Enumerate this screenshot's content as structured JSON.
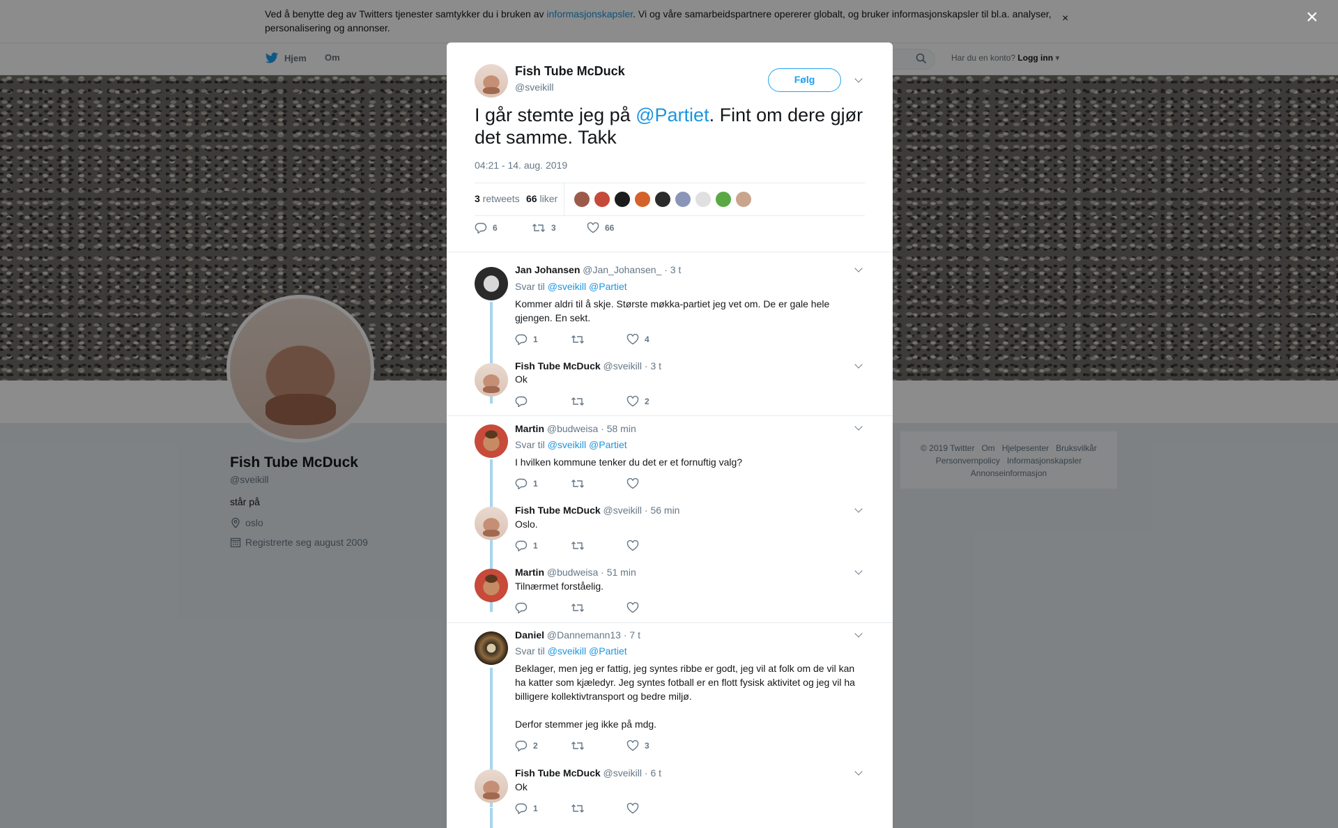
{
  "cookie": {
    "text_before": "Ved å benytte deg av Twitters tjenester samtykker du i bruken av ",
    "link": "informasjonskapsler",
    "text_after": ". Vi og våre samarbeidspartnere opererer globalt, og bruker informasjonskapsler til bl.a. analyser, personalisering og annonser.",
    "close": "×"
  },
  "nav": {
    "home": "Hjem",
    "about": "Om",
    "login_prompt": "Har du en konto?",
    "login": "Logg inn"
  },
  "profile": {
    "name": "Fish Tube McDuck",
    "handle": "@sveikill",
    "bio": "står på",
    "location": "oslo",
    "joined": "Registrerte seg august 2009"
  },
  "footer": {
    "links": [
      "© 2019 Twitter",
      "Om",
      "Hjelpesenter",
      "Bruksvilkår",
      "Personvernpolicy",
      "Informasjonskapsler",
      "Annonseinformasjon"
    ]
  },
  "overlay_close": "×",
  "tweet": {
    "name": "Fish Tube McDuck",
    "handle": "@sveikill",
    "follow": "Følg",
    "text_before": "I går stemte jeg på ",
    "mention": "@Partiet",
    "text_after": ". Fint om dere gjør det samme. Takk",
    "time": "04:21 - 14. aug. 2019",
    "retweets_count": "3",
    "retweets_label": " retweets",
    "likes_count": "66",
    "likes_label": " liker",
    "liker_colors": [
      "#9c5b4a",
      "#c44a3a",
      "#1c1c1c",
      "#d4622a",
      "#2b2b2b",
      "#8a96b8",
      "#e0e0e0",
      "#5aa843",
      "#c9a58d"
    ],
    "actions": {
      "replies": "6",
      "retweets": "3",
      "likes": "66"
    }
  },
  "replies": [
    {
      "name": "Jan Johansen",
      "handle": "@Jan_Johansen_",
      "time": "· 3 t",
      "reply_prefix": "Svar til ",
      "reply_to": "@sveikill @Partiet",
      "text": "Kommer aldri til å skje. Største møkka-partiet jeg vet om. De er gale hele gjengen. En sekt.",
      "replies": "1",
      "retweets": "",
      "likes": "4"
    },
    {
      "name": "Fish Tube McDuck",
      "handle": "@sveikill",
      "time": "· 3 t",
      "text": "Ok",
      "replies": "",
      "retweets": "",
      "likes": "2"
    },
    {
      "name": "Martin",
      "handle": "@budweisa",
      "time": "· 58 min",
      "reply_prefix": "Svar til ",
      "reply_to": "@sveikill @Partiet",
      "text": "I hvilken kommune tenker du det er et fornuftig valg?",
      "replies": "1",
      "retweets": "",
      "likes": ""
    },
    {
      "name": "Fish Tube McDuck",
      "handle": "@sveikill",
      "time": "· 56 min",
      "text": "Oslo.",
      "replies": "1",
      "retweets": "",
      "likes": ""
    },
    {
      "name": "Martin",
      "handle": "@budweisa",
      "time": "· 51 min",
      "text": "Tilnærmet forståelig.",
      "replies": "",
      "retweets": "",
      "likes": ""
    },
    {
      "name": "Daniel",
      "handle": "@Dannemann13",
      "time": "· 7 t",
      "reply_prefix": "Svar til ",
      "reply_to": "@sveikill @Partiet",
      "text": "Beklager, men jeg er fattig, jeg syntes ribbe er godt, jeg vil at folk om de vil kan ha katter som kjæledyr. Jeg syntes fotball er en flott fysisk aktivitet og jeg vil ha billigere kollektivtransport og bedre miljø.",
      "text2": "Derfor stemmer jeg ikke på mdg.",
      "replies": "2",
      "retweets": "",
      "likes": "3"
    },
    {
      "name": "Fish Tube McDuck",
      "handle": "@sveikill",
      "time": "· 6 t",
      "text": "Ok",
      "replies": "1",
      "retweets": "",
      "likes": ""
    }
  ],
  "colors": {
    "accent": "#1da1f2",
    "link": "#1b95e0",
    "thread": "#a6d6ef"
  }
}
